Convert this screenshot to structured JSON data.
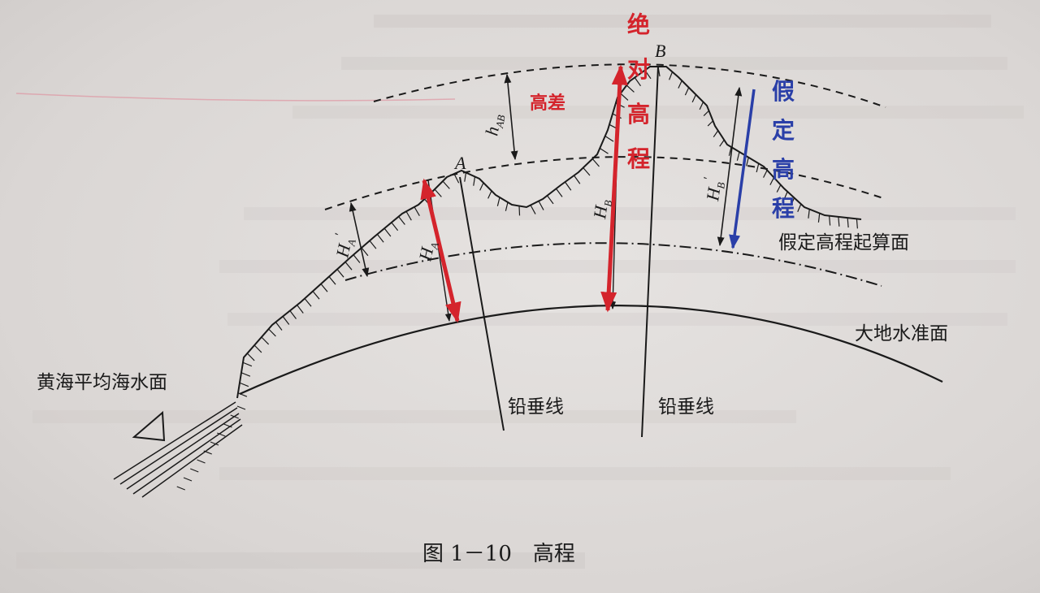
{
  "diagram": {
    "points": {
      "a": "A",
      "b": "B"
    },
    "heights": {
      "ha": "H",
      "ha_sub": "A",
      "hb": "H",
      "hb_sub": "B",
      "ha_prime": "H",
      "ha_prime_sub": "A",
      "ha_prime_mark": "′",
      "hb_prime": "H",
      "hb_prime_sub": "B",
      "hb_prime_mark": "′",
      "hab": "h",
      "hab_sub": "AB"
    },
    "labels": {
      "assumed_datum": "假定高程起算面",
      "geoid": "大地水准面",
      "mean_sea": "黄海平均海水面",
      "plumb_1": "铅垂线",
      "plumb_2": "铅垂线"
    },
    "annotations": {
      "red_diff": "高差",
      "red_absolute": "绝对高程",
      "blue_assumed": "假定高程"
    },
    "caption": "图 1－10　高程"
  },
  "colors": {
    "ink": "#1a1a1a",
    "red": "#d4242c",
    "blue": "#2a3fa8",
    "paper": "#dcd8d6"
  }
}
